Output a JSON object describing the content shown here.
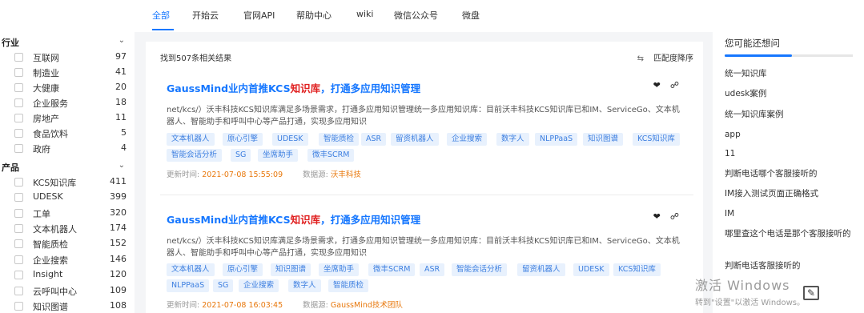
{
  "topnav": {
    "tabs": [
      "全部",
      "开始云",
      "官网API",
      "帮助中心",
      "wiki",
      "微信公众号",
      "微盘"
    ]
  },
  "sidebar": {
    "groups": [
      {
        "title": "行业",
        "items": [
          {
            "label": "互联网",
            "count": "97"
          },
          {
            "label": "制造业",
            "count": "41"
          },
          {
            "label": "大健康",
            "count": "20"
          },
          {
            "label": "企业服务",
            "count": "18"
          },
          {
            "label": "房地产",
            "count": "11"
          },
          {
            "label": "食品饮料",
            "count": "5"
          },
          {
            "label": "政府",
            "count": "4"
          }
        ]
      },
      {
        "title": "产品",
        "items": [
          {
            "label": "KCS知识库",
            "count": "411"
          },
          {
            "label": "UDESK",
            "count": "399"
          },
          {
            "label": "工单",
            "count": "320"
          },
          {
            "label": "文本机器人",
            "count": "174"
          },
          {
            "label": "智能质检",
            "count": "152"
          },
          {
            "label": "企业搜索",
            "count": "146"
          },
          {
            "label": "Insight",
            "count": "120"
          },
          {
            "label": "云呼叫中心",
            "count": "109"
          },
          {
            "label": "知识图谱",
            "count": "108"
          }
        ]
      }
    ]
  },
  "main": {
    "summary": "找到507条相关结果",
    "sort_label": "匹配度降序",
    "results": [
      {
        "title_prefix": "GaussMind业内首推KCS",
        "title_highlight": "知识库",
        "title_suffix": "，打通多应用知识管理",
        "snippet": "net/kcs/）沃丰科技KCS知识库满足多场景需求，打通多应用知识管理统一多应用知识库：目前沃丰科技KCS知识库已和IM、ServiceGo、文本机器人、智能助手和呼叫中心等产品打通，实现多应用知识",
        "tags": [
          "文本机器人",
          "原心引擎",
          "UDESK",
          "智能质检",
          "ASR",
          "留资机器人",
          "企业搜索",
          "数字人",
          "NLPPaaS",
          "知识图谱",
          "KCS知识库",
          "智能会话分析",
          "SG",
          "坐席助手",
          "微丰SCRM"
        ],
        "meta_time_label": "更新时间:",
        "meta_time": "2021-07-08 15:55:09",
        "meta_source_label": "数据源:",
        "meta_source": "沃丰科技"
      },
      {
        "title_prefix": "GaussMind业内首推KCS",
        "title_highlight": "知识库",
        "title_suffix": "，打通多应用知识管理",
        "snippet": "net/kcs/）沃丰科技KCS知识库满足多场景需求，打通多应用知识管理统一多应用知识库：目前沃丰科技KCS知识库已和IM、ServiceGo、文本机器人、智能助手和呼叫中心等产品打通，实现多应用知识",
        "tags": [
          "文本机器人",
          "原心引擎",
          "知识图谱",
          "坐席助手",
          "微丰SCRM",
          "ASR",
          "智能会话分析",
          "留资机器人",
          "UDESK",
          "KCS知识库",
          "NLPPaaS",
          "SG",
          "企业搜索",
          "数字人",
          "智能质检"
        ],
        "meta_time_label": "更新时间:",
        "meta_time": "2021-07-08 16:03:45",
        "meta_source_label": "数据源:",
        "meta_source": "GaussMind技术团队"
      }
    ]
  },
  "rightbar": {
    "title": "您可能还想问",
    "items": [
      "统一知识库",
      "udesk案例",
      "统一知识库案例",
      "app",
      "11",
      "判断电话哪个客服接听的",
      "IM接入测试页面正确格式",
      "IM",
      "哪里查这个电话是那个客服接听的",
      "判断电话客服接听的"
    ]
  },
  "watermark": {
    "line1": "激活 Windows",
    "line2": "转到\"设置\"以激活 Windows。"
  },
  "colors": {
    "accent": "#1677ff",
    "highlight": "#e02020",
    "tag_bg": "#e8f1fd",
    "meta_value": "#e8780c"
  }
}
